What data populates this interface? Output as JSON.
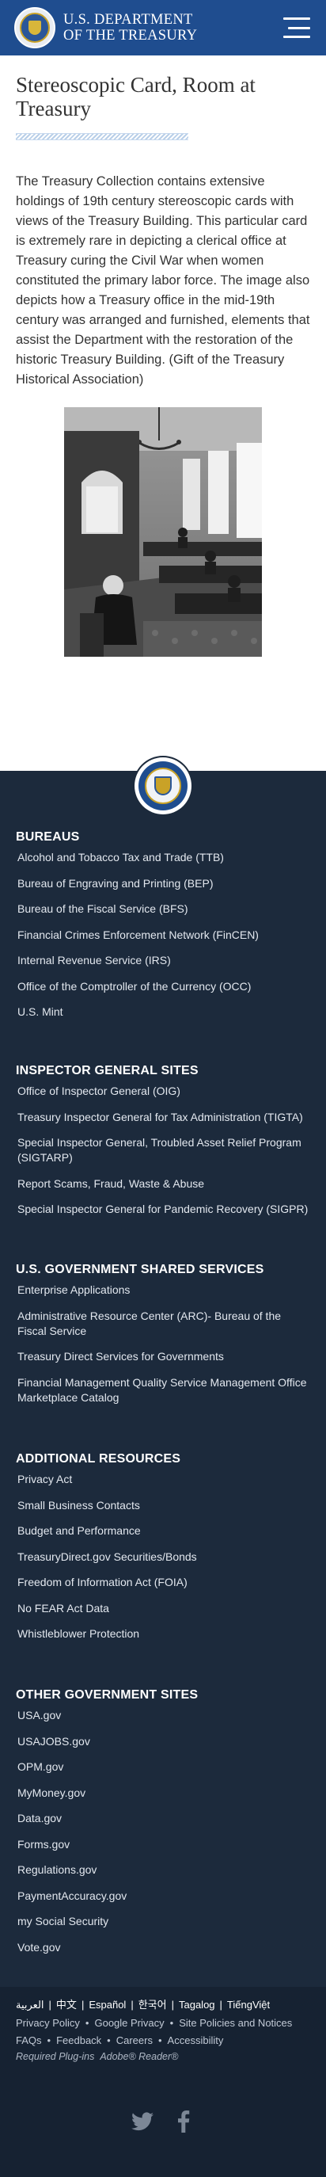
{
  "header": {
    "title_line1": "U.S. DEPARTMENT",
    "title_line2": "OF THE TREASURY"
  },
  "main": {
    "title": "Stereoscopic Card, Room at Treasury",
    "body": "The Treasury Collection contains extensive holdings of 19th century stereoscopic cards with views of the Treasury Building. This particular card is extremely rare in depicting a clerical office at Treasury curing the Civil War when women constituted the primary labor force. The image also depicts how a Treasury office in the mid-19th century was arranged and furnished, elements that assist the Department with the restoration of the historic Treasury Building. (Gift of the Treasury Historical Association)"
  },
  "footer": {
    "sections": [
      {
        "heading": "BUREAUS",
        "items": [
          "Alcohol and Tobacco Tax and Trade (TTB)",
          "Bureau of Engraving and Printing (BEP)",
          "Bureau of the Fiscal Service (BFS)",
          "Financial Crimes Enforcement Network (FinCEN)",
          "Internal Revenue Service (IRS)",
          "Office of the Comptroller of the Currency (OCC)",
          "U.S. Mint"
        ]
      },
      {
        "heading": "INSPECTOR GENERAL SITES",
        "items": [
          "Office of Inspector General (OIG)",
          "Treasury Inspector General for Tax Administration (TIGTA)",
          "Special Inspector General, Troubled Asset Relief Program (SIGTARP)",
          "Report Scams, Fraud, Waste & Abuse",
          "Special Inspector General for Pandemic Recovery (SIGPR)"
        ]
      },
      {
        "heading": "U.S. GOVERNMENT SHARED SERVICES",
        "items": [
          "Enterprise Applications",
          "Administrative Resource Center (ARC)- Bureau of the Fiscal Service",
          "Treasury Direct Services for Governments",
          "Financial Management Quality Service Management Office Marketplace Catalog"
        ]
      },
      {
        "heading": "ADDITIONAL RESOURCES",
        "items": [
          "Privacy Act",
          "Small Business Contacts",
          "Budget and Performance",
          "TreasuryDirect.gov Securities/Bonds",
          "Freedom of Information Act (FOIA)",
          "No FEAR Act Data",
          "Whistleblower Protection"
        ]
      },
      {
        "heading": "OTHER GOVERNMENT SITES",
        "items": [
          "USA.gov",
          "USAJOBS.gov",
          "OPM.gov",
          "MyMoney.gov",
          "Data.gov",
          "Forms.gov",
          "Regulations.gov",
          "PaymentAccuracy.gov",
          "my Social Security",
          "Vote.gov"
        ]
      }
    ],
    "languages": [
      "العربية",
      "中文",
      "Español",
      "한국어",
      "Tagalog",
      "TiếngViệt"
    ],
    "policy_links": [
      "Privacy Policy",
      "Google Privacy",
      "Site Policies and Notices",
      "FAQs",
      "Feedback",
      "Careers",
      "Accessibility"
    ],
    "plugins_text": "Required Plug-ins",
    "plugins_link": "Adobe® Reader®",
    "social": [
      "twitter-icon",
      "facebook-icon"
    ]
  }
}
